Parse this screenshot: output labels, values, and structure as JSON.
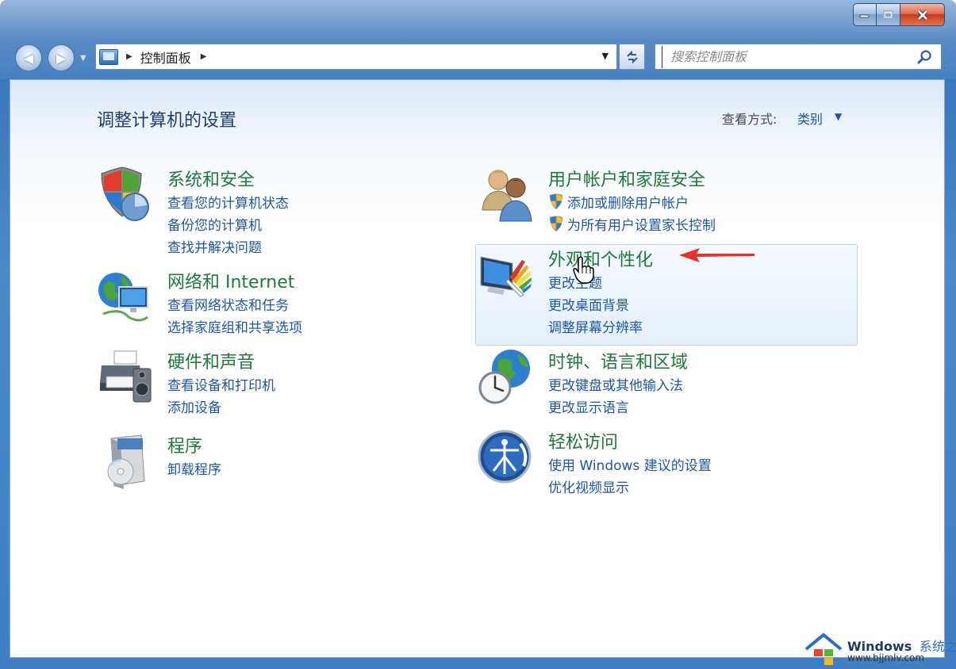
{
  "window": {
    "minimize_icon": "minimize-icon",
    "maximize_icon": "maximize-icon",
    "close_icon": "close-icon"
  },
  "nav": {
    "address_path": "控制面板",
    "search_placeholder": "搜索控制面板"
  },
  "header": {
    "title": "调整计算机的设置",
    "view_by_label": "查看方式:",
    "view_by_value": "类别"
  },
  "categories": [
    {
      "title": "系统和安全",
      "icon": "shield-icon",
      "links": [
        "查看您的计算机状态",
        "备份您的计算机",
        "查找并解决问题"
      ]
    },
    {
      "title": "网络和 Internet",
      "icon": "network-globe-icon",
      "links": [
        "查看网络状态和任务",
        "选择家庭组和共享选项"
      ]
    },
    {
      "title": "硬件和声音",
      "icon": "printer-speaker-icon",
      "links": [
        "查看设备和打印机",
        "添加设备"
      ]
    },
    {
      "title": "程序",
      "icon": "programs-disc-icon",
      "links": [
        "卸载程序"
      ]
    },
    {
      "title": "用户帐户和家庭安全",
      "icon": "users-icon",
      "links": [
        "添加或删除用户帐户",
        "为所有用户设置家长控制"
      ]
    },
    {
      "title": "外观和个性化",
      "icon": "display-palette-icon",
      "links": [
        "更改主题",
        "更改桌面背景",
        "调整屏幕分辨率"
      ]
    },
    {
      "title": "时钟、语言和区域",
      "icon": "clock-globe-icon",
      "links": [
        "更改键盘或其他输入法",
        "更改显示语言"
      ]
    },
    {
      "title": "轻松访问",
      "icon": "ease-of-access-icon",
      "links": [
        "使用 Windows 建议的设置",
        "优化视频显示"
      ]
    }
  ],
  "watermark": {
    "brand": "Windows",
    "site_name": "系统之家",
    "url": "www.bjjmlv.com"
  },
  "colors": {
    "category_title": "#1e7a3a",
    "link": "#1d56a8",
    "page_title": "#1e3f6b",
    "highlight_border": "#b8d3ef"
  }
}
